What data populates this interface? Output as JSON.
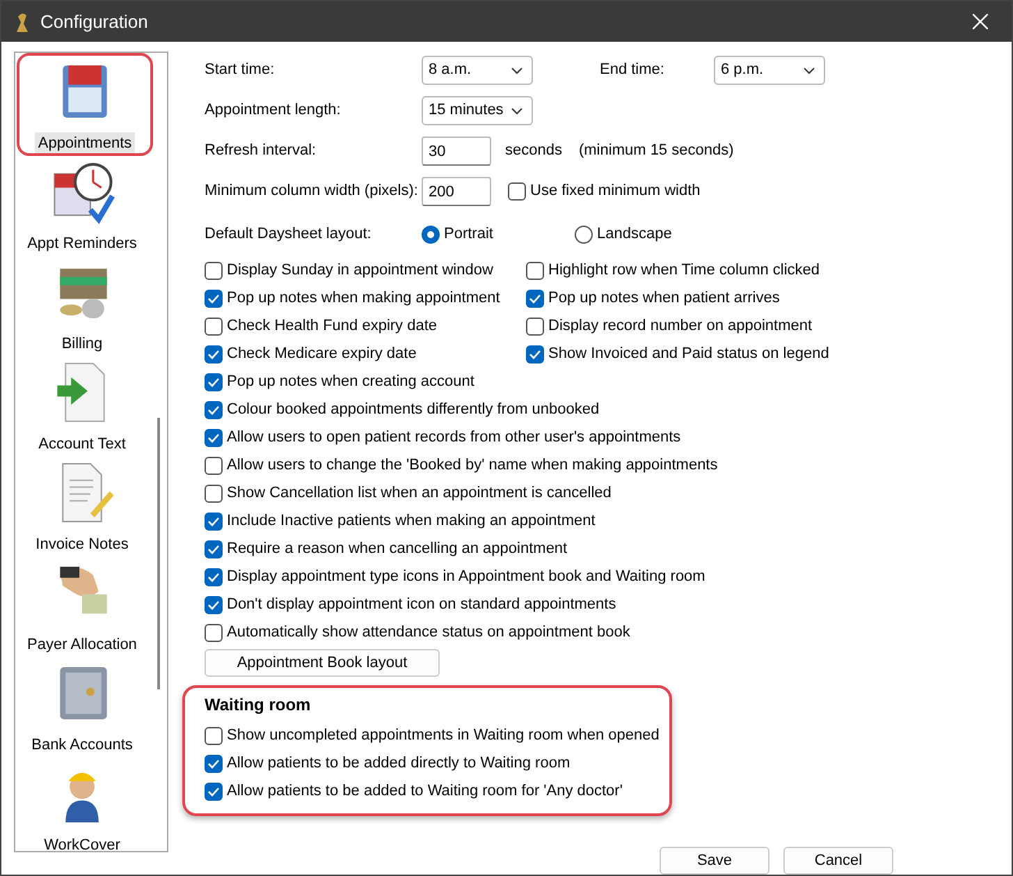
{
  "window": {
    "title": "Configuration"
  },
  "sidebar": {
    "items": [
      {
        "label": "Appointments",
        "selected": true
      },
      {
        "label": "Appt Reminders",
        "selected": false
      },
      {
        "label": "Billing",
        "selected": false
      },
      {
        "label": "Account Text",
        "selected": false
      },
      {
        "label": "Invoice Notes",
        "selected": false
      },
      {
        "label": "Payer Allocation",
        "selected": false
      },
      {
        "label": "Bank Accounts",
        "selected": false
      },
      {
        "label": "WorkCover",
        "selected": false
      }
    ]
  },
  "start_time": {
    "label": "Start time:",
    "value": "8 a.m."
  },
  "end_time": {
    "label": "End time:",
    "value": "6 p.m."
  },
  "appointment_length": {
    "label": "Appointment length:",
    "value": "15 minutes"
  },
  "refresh_interval": {
    "label": "Refresh interval:",
    "value": "30",
    "unit": "seconds",
    "note": "(minimum 15 seconds)"
  },
  "minimum_column_width": {
    "label": "Minimum column width (pixels):",
    "value": "200"
  },
  "fixed_width": {
    "label": "Use fixed minimum width",
    "checked": false
  },
  "daysheet_layout": {
    "label": "Default Daysheet layout:",
    "options": [
      {
        "label": "Portrait",
        "selected": true
      },
      {
        "label": "Landscape",
        "selected": false
      }
    ]
  },
  "paired_options": [
    {
      "label": "Display Sunday in appointment window",
      "checked": false
    },
    {
      "label": "Highlight row when Time column clicked",
      "checked": false
    },
    {
      "label": "Pop up notes when making appointment",
      "checked": true
    },
    {
      "label": "Pop up notes when patient arrives",
      "checked": true
    },
    {
      "label": "Check Health Fund expiry date",
      "checked": false
    },
    {
      "label": "Display record number on appointment",
      "checked": false
    },
    {
      "label": "Check Medicare expiry date",
      "checked": true
    },
    {
      "label": "Show Invoiced and Paid status on legend",
      "checked": true
    }
  ],
  "options": [
    {
      "label": "Pop up notes when creating account",
      "checked": true
    },
    {
      "label": "Colour booked appointments differently from unbooked",
      "checked": true
    },
    {
      "label": "Allow users to open patient records from other user's appointments",
      "checked": true
    },
    {
      "label": "Allow users to change the 'Booked by' name when making appointments",
      "checked": false
    },
    {
      "label": "Show Cancellation list when an appointment is cancelled",
      "checked": false
    },
    {
      "label": "Include Inactive patients when making an appointment",
      "checked": true
    },
    {
      "label": "Require a reason when cancelling an appointment",
      "checked": true
    },
    {
      "label": "Display appointment type icons in Appointment book and Waiting room",
      "checked": true
    },
    {
      "label": "Don't display appointment icon on standard appointments",
      "checked": true
    },
    {
      "label": "Automatically show attendance status on appointment book",
      "checked": false
    }
  ],
  "layout_button": "Appointment Book layout",
  "waiting_room": {
    "title": "Waiting room",
    "options": [
      {
        "label": "Show uncompleted appointments in Waiting room when opened",
        "checked": false
      },
      {
        "label": "Allow patients to be added directly to Waiting room",
        "checked": true
      },
      {
        "label": "Allow patients to be added to Waiting room for 'Any doctor'",
        "checked": true
      }
    ]
  },
  "buttons": [
    "Save",
    "Cancel"
  ]
}
